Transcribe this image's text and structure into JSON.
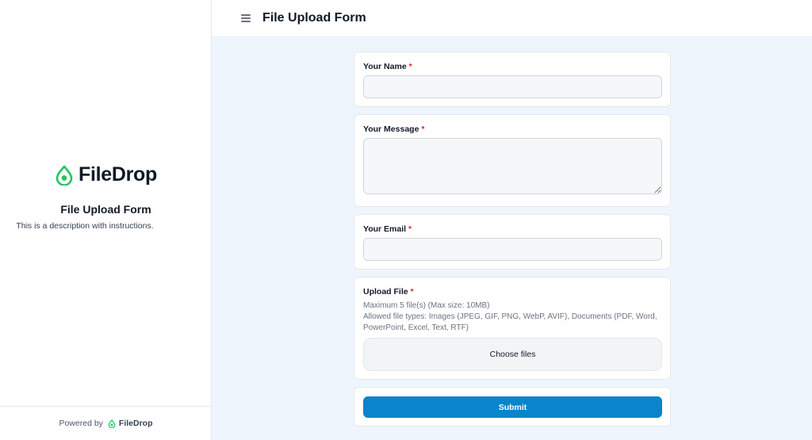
{
  "sidebar": {
    "brand_name": "FileDrop",
    "form_title": "File Upload Form",
    "description": "This is a description with instructions.",
    "footer_prefix": "Powered by",
    "footer_brand": "FileDrop"
  },
  "header": {
    "title": "File Upload Form",
    "menu_icon": "hamburger-menu-icon"
  },
  "form": {
    "name": {
      "label": "Your Name",
      "required": "*",
      "value": ""
    },
    "message": {
      "label": "Your Message",
      "required": "*",
      "value": ""
    },
    "email": {
      "label": "Your Email",
      "required": "*",
      "value": ""
    },
    "upload": {
      "label": "Upload File",
      "required": "*",
      "max_info": "Maximum 5 file(s) (Max size: 10MB)",
      "allowed_types": "Allowed file types: Images (JPEG, GIF, PNG, WebP, AVIF), Documents (PDF, Word, PowerPoint, Excel, Text, RTF)",
      "choose_label": "Choose files"
    },
    "submit_label": "Submit"
  },
  "colors": {
    "brand_green": "#22c55e",
    "submit_blue": "#0a84cc",
    "required_red": "#dc2626",
    "main_background": "#eef5fd"
  }
}
